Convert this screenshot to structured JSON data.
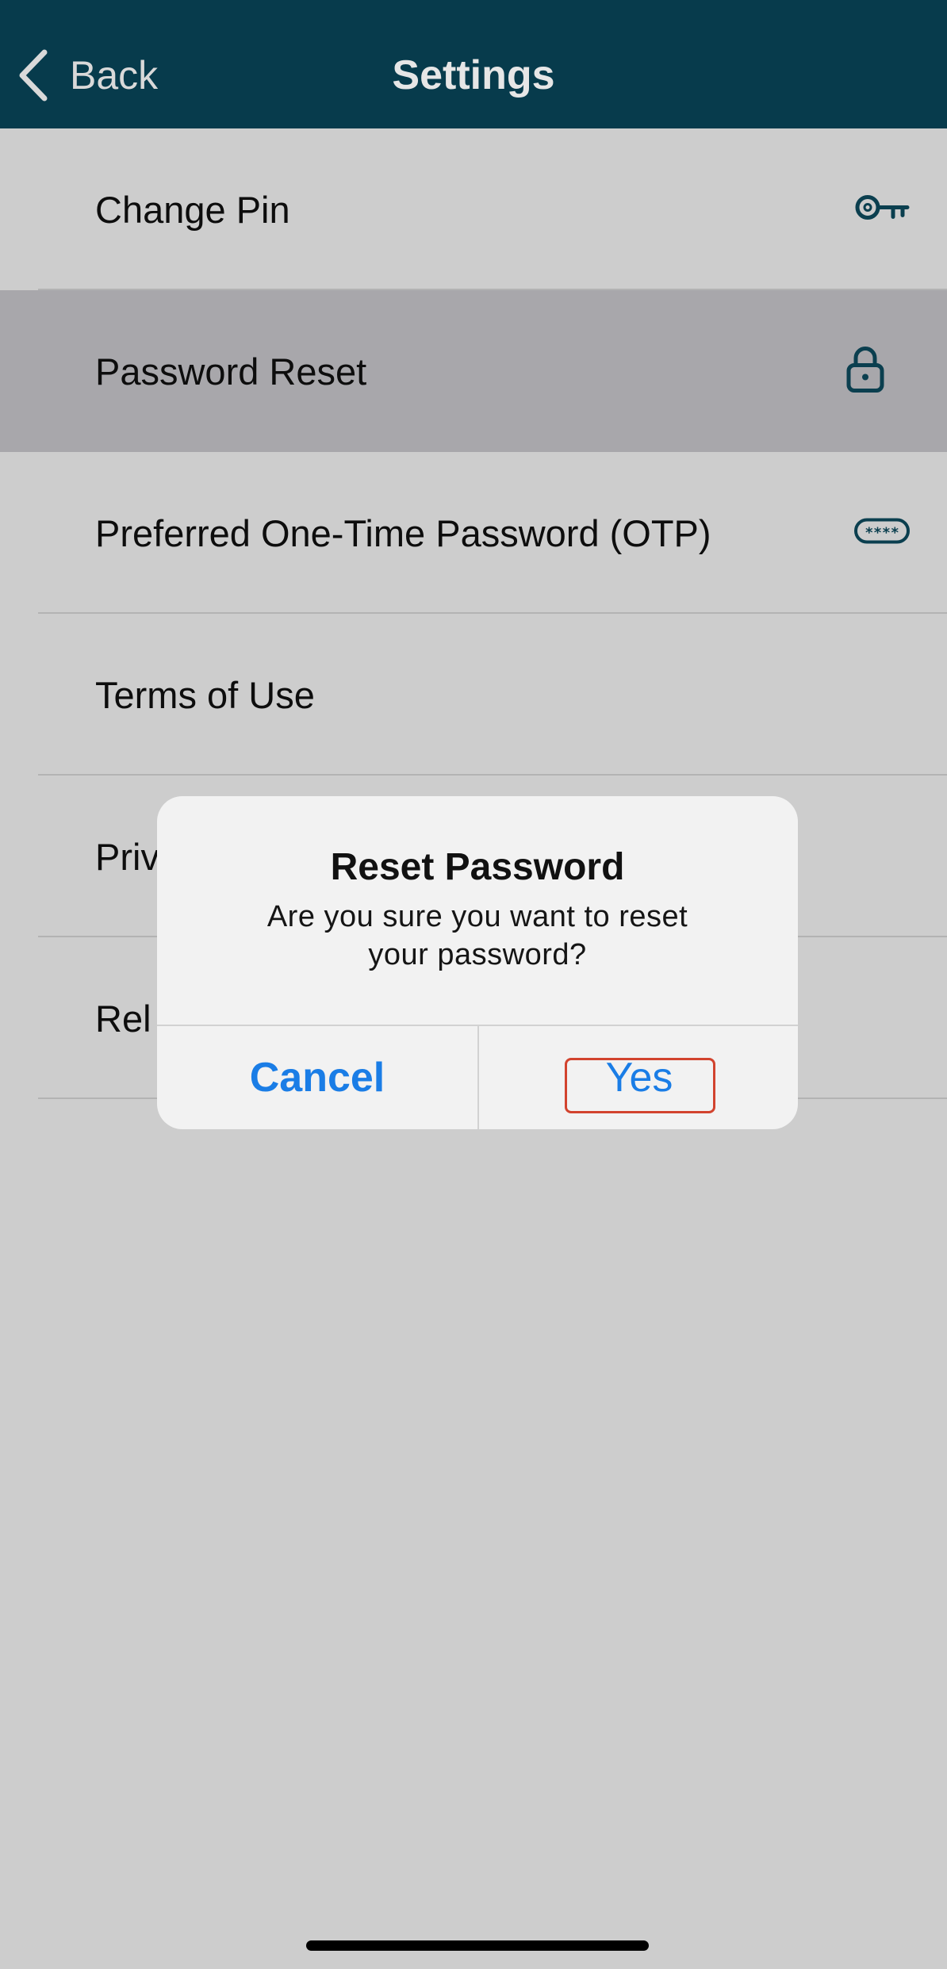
{
  "navbar": {
    "back_label": "Back",
    "title": "Settings",
    "background": "#073b4c"
  },
  "settings_items": [
    {
      "label": "Change Pin",
      "icon": "key-icon",
      "selected": false
    },
    {
      "label": "Password Reset",
      "icon": "lock-icon",
      "selected": true
    },
    {
      "label": "Preferred One-Time Password (OTP)",
      "icon": "password-field-icon",
      "selected": false
    },
    {
      "label": "Terms of Use",
      "icon": null,
      "selected": false
    },
    {
      "label": "Priv",
      "icon": null,
      "selected": false
    },
    {
      "label": "Rel",
      "icon": null,
      "selected": false
    }
  ],
  "dialog": {
    "title": "Reset Password",
    "message_line1": "Are you sure you want to reset",
    "message_line2": "your password?",
    "cancel_label": "Cancel",
    "yes_label": "Yes",
    "accent_color": "#1a7de6",
    "highlight_color": "#d2432e"
  }
}
